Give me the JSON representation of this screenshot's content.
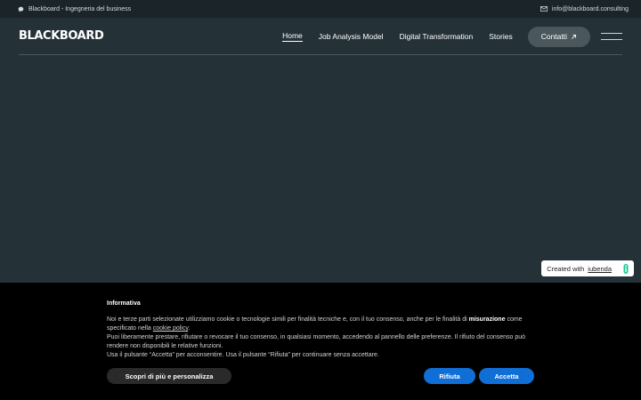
{
  "topbar": {
    "company": "Blackboard - Ingegneria del business",
    "email": "info@blackboard.consulting"
  },
  "header": {
    "logo": "BLACKBOARD",
    "nav": [
      "Home",
      "Job Analysis Model",
      "Digital Transformation",
      "Stories"
    ],
    "active_nav": "Home",
    "contact_label": "Contatti"
  },
  "iubenda_badge": {
    "prefix": "Created with",
    "brand": "iubenda"
  },
  "cookie_banner": {
    "title": "Informativa",
    "para1_a": "Noi e terze parti selezionate utilizziamo cookie o tecnologie simili per finalità tecniche e, con il tuo consenso, anche per le finalità di",
    "para1_bold": "misurazione",
    "para1_b": "come specificato nella",
    "para1_link": "cookie policy",
    "para1_end": ".",
    "para2": "Puoi liberamente prestare, rifiutare o revocare il tuo consenso, in qualsiasi momento, accedendo al pannello delle preferenze. Il rifiuto del consenso può rendere non disponibili le relative funzioni.",
    "para3": "Usa il pulsante “Accetta” per acconsentire. Usa il pulsante “Rifiuta” per continuare senza accettare.",
    "more_button": "Scopri di più e personalizza",
    "reject_button": "Rifiuta",
    "accept_button": "Accetta"
  },
  "colors": {
    "page_bg": "#243238",
    "topbar_bg": "#1b2428",
    "contact_bg": "#4a575c",
    "banner_bg": "#000000",
    "button_blue": "#0f6fd6",
    "iubenda_green": "#1cc691"
  },
  "icons": {
    "company": "chat-bubble-icon",
    "email": "envelope-icon",
    "contact": "arrow-up-right-icon",
    "menu": "hamburger-menu-icon",
    "iubenda": "iubenda-logo-icon"
  }
}
